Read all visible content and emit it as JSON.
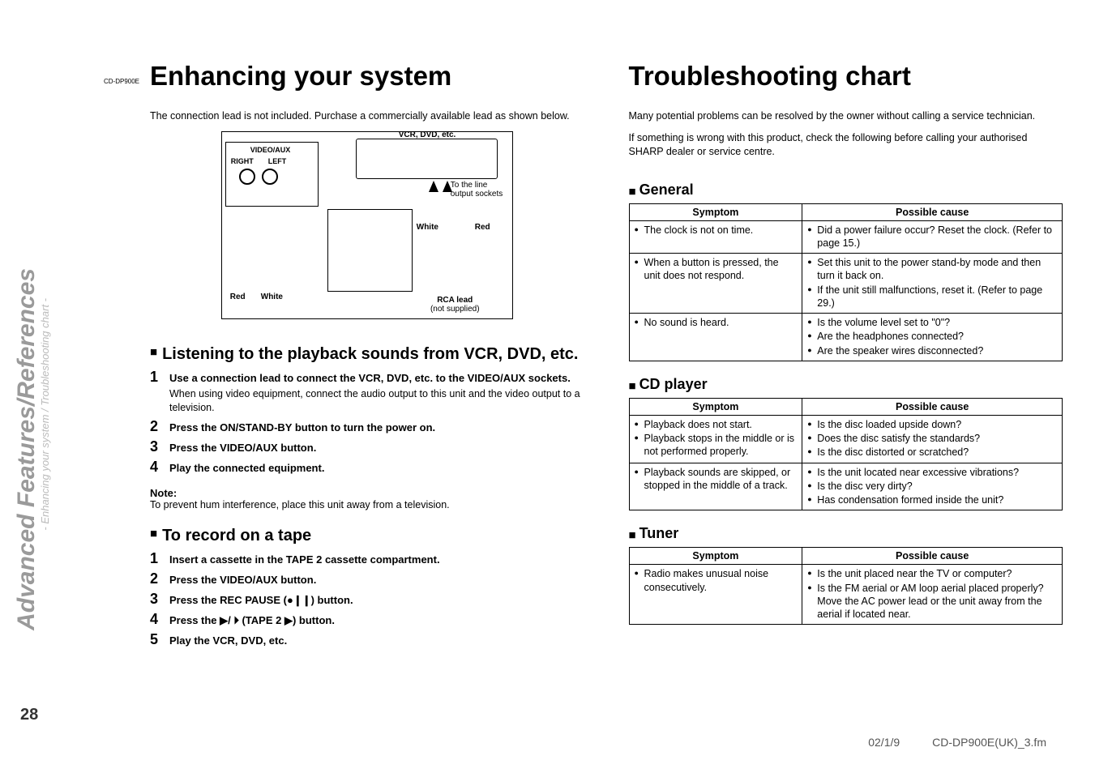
{
  "model_code": "CD-DP900E",
  "page_number": "28",
  "sidebar": {
    "title": "Advanced Features/References",
    "subtitle": "- Enhancing your system / Troubleshooting chart -"
  },
  "left": {
    "heading": "Enhancing your system",
    "intro": "The connection lead is not included. Purchase a commercially available lead as shown below.",
    "diagram": {
      "vcr_label": "VCR, DVD, etc.",
      "video_aux": "VIDEO/AUX",
      "right": "RIGHT",
      "left": "LEFT",
      "line_out": "To the line output sockets",
      "white": "White",
      "red": "Red",
      "red2": "Red",
      "white2": "White",
      "rca_lead": "RCA lead",
      "not_supplied": "(not supplied)"
    },
    "section1_title": "Listening to the playback sounds from VCR, DVD, etc.",
    "steps1": [
      {
        "title": "Use a connection lead to connect the VCR, DVD, etc. to the VIDEO/AUX sockets.",
        "desc": "When using video equipment, connect the audio output to this unit and the video output to a television."
      },
      {
        "title": "Press the ON/STAND-BY button to turn the power on."
      },
      {
        "title": "Press the VIDEO/AUX button."
      },
      {
        "title": "Play the connected equipment."
      }
    ],
    "note_label": "Note:",
    "note_text": "To prevent hum interference, place this unit away from a television.",
    "section2_title": "To record on a tape",
    "steps2": [
      {
        "title": "Insert a cassette in the TAPE 2 cassette compartment."
      },
      {
        "title": "Press the VIDEO/AUX button."
      },
      {
        "title": "Press the REC PAUSE (●❙❙) button."
      },
      {
        "title": "Press the ▶/ ⏵ (TAPE 2 ▶) button."
      },
      {
        "title": "Play the VCR, DVD, etc."
      }
    ]
  },
  "right": {
    "heading": "Troubleshooting chart",
    "intro1": "Many potential problems can be resolved by the owner without calling a service technician.",
    "intro2": "If something is wrong with this product, check the following before calling your authorised SHARP dealer or service centre.",
    "tables": {
      "general": {
        "title": "General",
        "header_symptom": "Symptom",
        "header_cause": "Possible cause",
        "rows": [
          {
            "symptoms": [
              "The clock is not on time."
            ],
            "causes": [
              "Did a power failure occur? Reset the clock. (Refer to page 15.)"
            ]
          },
          {
            "symptoms": [
              "When a button is pressed, the unit does not respond."
            ],
            "causes": [
              "Set this unit to the power stand-by mode and then turn it back on.",
              "If the unit still malfunctions, reset it. (Refer to page 29.)"
            ]
          },
          {
            "symptoms": [
              "No sound is heard."
            ],
            "causes": [
              "Is the volume level set to \"0\"?",
              "Are the headphones connected?",
              "Are the speaker wires disconnected?"
            ]
          }
        ]
      },
      "cd": {
        "title": "CD player",
        "header_symptom": "Symptom",
        "header_cause": "Possible cause",
        "rows": [
          {
            "symptoms": [
              "Playback does not start.",
              "Playback stops in the middle or is not performed properly."
            ],
            "causes": [
              "Is the disc loaded upside down?",
              "Does the disc satisfy the standards?",
              "Is the disc distorted or scratched?"
            ]
          },
          {
            "symptoms": [
              "Playback sounds are skipped, or stopped in the middle of a track."
            ],
            "causes": [
              "Is the unit located near excessive vibrations?",
              "Is the disc very dirty?",
              "Has condensation formed inside the unit?"
            ]
          }
        ]
      },
      "tuner": {
        "title": "Tuner",
        "header_symptom": "Symptom",
        "header_cause": "Possible cause",
        "rows": [
          {
            "symptoms": [
              "Radio makes unusual noise consecutively."
            ],
            "causes": [
              "Is the unit placed near the TV or computer?",
              "Is the FM aerial or AM loop aerial placed properly? Move the AC power lead or the unit away from the aerial if located near."
            ]
          }
        ]
      }
    }
  },
  "footer": {
    "date": "02/1/9",
    "file": "CD-DP900E(UK)_3.fm"
  }
}
